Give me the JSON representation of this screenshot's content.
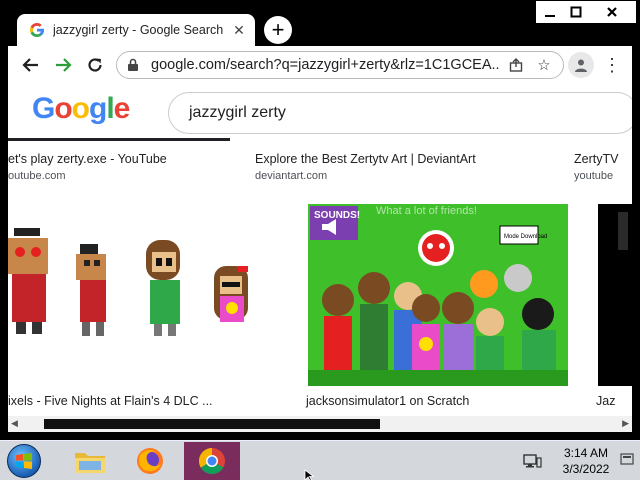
{
  "window": {
    "min_icon": "minimize-icon",
    "max_icon": "maximize-icon",
    "close_icon": "close-icon"
  },
  "tab": {
    "favicon": "G",
    "title": "jazzygirl zerty - Google Search",
    "close_glyph": "✕",
    "new_tab_glyph": "+"
  },
  "toolbar": {
    "back_glyph": "←",
    "forward_glyph": "→",
    "reload_glyph": "↻",
    "url": "google.com/search?q=jazzygirl+zerty&rlz=1C1GCEA...",
    "share_icon": "share-icon",
    "star_glyph": "☆",
    "menu_glyph": "⋮"
  },
  "page": {
    "logo_letters": [
      "G",
      "o",
      "o",
      "g",
      "l",
      "e"
    ],
    "logo_colors": [
      "#4285f4",
      "#ea4335",
      "#fbbc05",
      "#4285f4",
      "#34a853",
      "#ea4335"
    ],
    "search_query": "jazzygirl zerty",
    "results": [
      {
        "title": "et's play zerty.exe - YouTube",
        "source": "outube.com"
      },
      {
        "title": "Explore the Best Zertytv Art | DeviantArt",
        "source": "deviantart.com"
      },
      {
        "title": "ZertyTV",
        "source": "youtube"
      }
    ],
    "captions": [
      "ixels - Five Nights at Flain's 4 DLC ...",
      "jacksonsimulator1 on Scratch",
      "Jaz"
    ],
    "thumb_mid_text": {
      "sounds": "SOUNDS!",
      "header": "What a lot of friends!",
      "badge": "Mode Download"
    }
  },
  "taskbar": {
    "apps": [
      "file-explorer",
      "firefox",
      "chrome"
    ],
    "time": "3:14 AM",
    "date": "3/3/2022"
  }
}
